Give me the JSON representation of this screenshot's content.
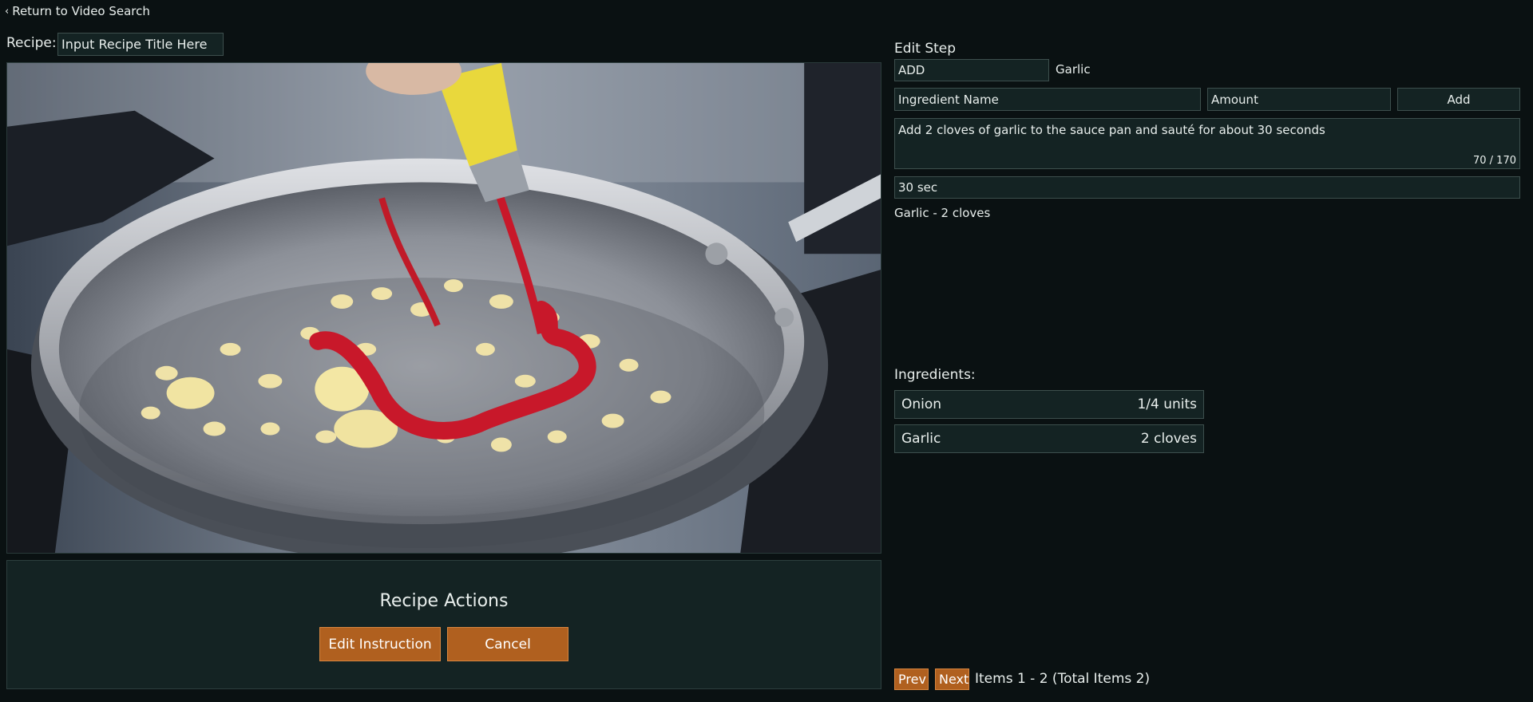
{
  "nav": {
    "back_label": "Return to Video Search",
    "back_icon": "chevron-left-icon"
  },
  "recipe": {
    "label": "Recipe:",
    "title_placeholder": "Input Recipe Title Here",
    "title_value": ""
  },
  "actions_panel": {
    "title": "Recipe Actions",
    "edit_label": "Edit Instruction",
    "cancel_label": "Cancel"
  },
  "edit_step": {
    "title": "Edit Step",
    "action_value": "ADD",
    "action_target": "Garlic",
    "ingredient_name_placeholder": "Ingredient Name",
    "amount_placeholder": "Amount",
    "add_label": "Add",
    "instruction_text": "Add 2 cloves of garlic to the sauce pan and sauté for about 30 seconds",
    "char_count": "70 / 170",
    "time_value": "30 sec",
    "summary": "Garlic - 2 cloves"
  },
  "ingredients": {
    "label": "Ingredients:",
    "items": [
      {
        "name": "Onion",
        "amount": "1/4 units"
      },
      {
        "name": "Garlic",
        "amount": "2 cloves"
      }
    ]
  },
  "pager": {
    "prev_label": "Prev",
    "next_label": "Next",
    "status": "Items 1 - 2 (Total Items 2)"
  },
  "colors": {
    "background": "#0a1112",
    "panel": "#142323",
    "accent": "#b0601f",
    "text": "#e8eeec"
  }
}
